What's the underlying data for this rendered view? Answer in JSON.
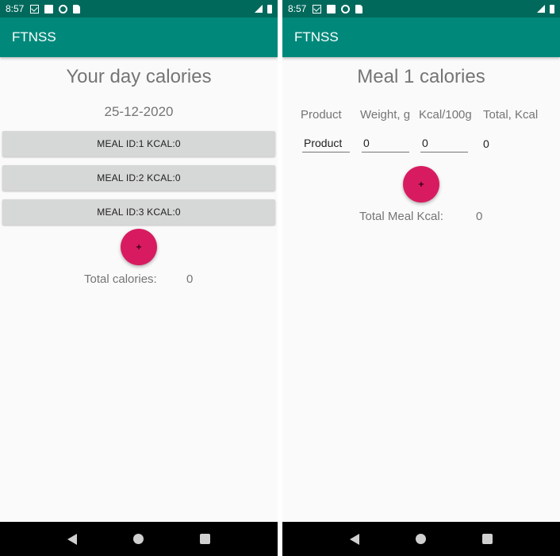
{
  "screens": [
    {
      "status": {
        "time": "8:57"
      },
      "toolbar_title": "FTNSS",
      "title": "Your day calories",
      "date": "25-12-2020",
      "meals": [
        {
          "label": "MEAL ID:1 KCAL:0"
        },
        {
          "label": "MEAL ID:2 KCAL:0"
        },
        {
          "label": "MEAL ID:3 KCAL:0"
        }
      ],
      "fab_label": "+",
      "total_label": "Total calories:",
      "total_value": "0"
    },
    {
      "status": {
        "time": "8:57"
      },
      "toolbar_title": "FTNSS",
      "title": "Meal 1 calories",
      "columns": [
        "Product",
        "Weight, g",
        "Kcal/100g",
        "Total, Kcal"
      ],
      "row": {
        "product_placeholder": "Product",
        "weight_value": "0",
        "kcal_value": "0",
        "total_value": "0"
      },
      "fab_label": "+",
      "total_label": "Total Meal Kcal:",
      "total_value": "0"
    }
  ],
  "colors": {
    "status_bar": "#00695c",
    "toolbar": "#00897b",
    "fab": "#d81b60",
    "meal_button": "#d6d7d7"
  },
  "icons": {
    "status_left": [
      "gmail-icon",
      "photo-icon",
      "sync-icon",
      "sd-card-icon"
    ],
    "status_right": [
      "signal-icon",
      "battery-icon"
    ],
    "nav": [
      "back-icon",
      "home-icon",
      "recents-icon"
    ]
  }
}
